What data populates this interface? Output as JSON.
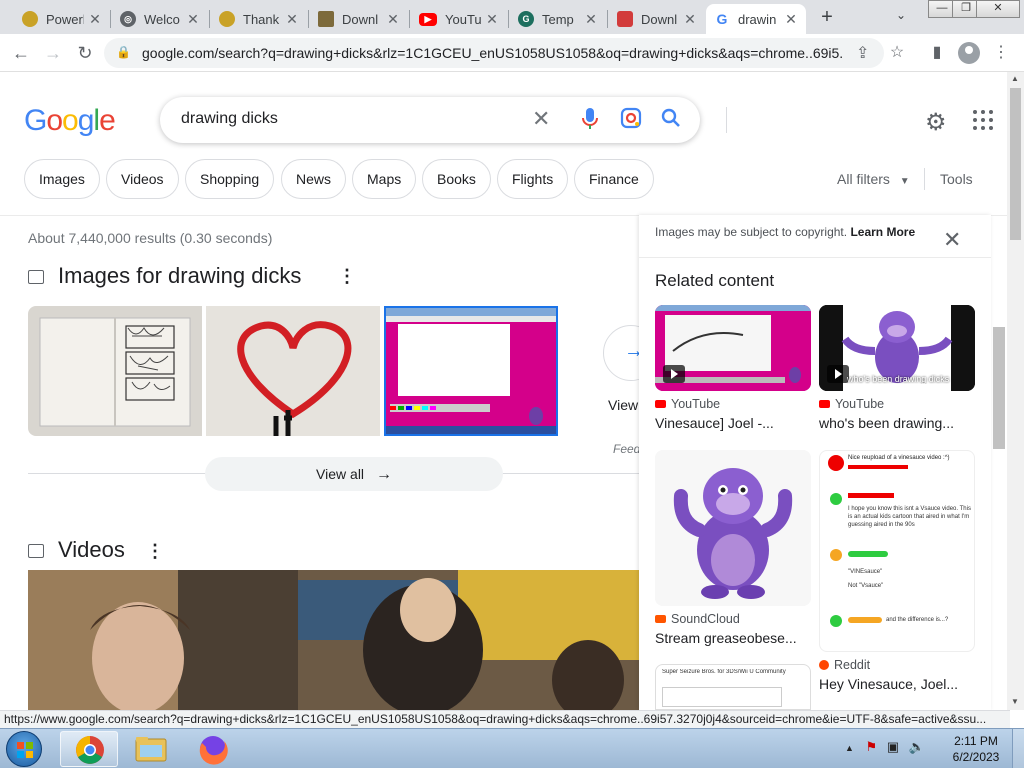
{
  "browser": {
    "tabs": [
      {
        "title": "Powerl",
        "icon": "coin-icon",
        "color": "#c9a227"
      },
      {
        "title": "Welco",
        "icon": "globe-icon",
        "color": "#5f6368"
      },
      {
        "title": "Thank",
        "icon": "coin-icon",
        "color": "#c9a227"
      },
      {
        "title": "Downl",
        "icon": "download-icon",
        "color": "#7d6a3b"
      },
      {
        "title": "YouTu",
        "icon": "youtube-icon",
        "color": "#ff0000"
      },
      {
        "title": "Temp",
        "icon": "temp-mail-icon",
        "color": "#1d6f5f"
      },
      {
        "title": "Downl",
        "icon": "download-page-icon",
        "color": "#d23b3b"
      },
      {
        "title": "drawin",
        "icon": "google-icon",
        "color": "#4285f4"
      }
    ],
    "url": "google.com/search?q=drawing+dicks&rlz=1C1GCEU_enUS1058US1058&oq=drawing+dicks&aqs=chrome..69i5...",
    "status_url": "https://www.google.com/search?q=drawing+dicks&rlz=1C1GCEU_enUS1058US1058&oq=drawing+dicks&aqs=chrome..69i57.3270j0j4&sourceid=chrome&ie=UTF-8&safe=active&ssu..."
  },
  "google": {
    "logo": "Google",
    "query": "drawing dicks",
    "filters": [
      "Images",
      "Videos",
      "Shopping",
      "News",
      "Maps",
      "Books",
      "Flights",
      "Finance"
    ],
    "all_filters": "All filters",
    "tools": "Tools",
    "stats": "About 7,440,000 results (0.30 seconds)",
    "images_heading": "Images for drawing dicks",
    "view_label": "View",
    "feedback_label": "Feed",
    "view_all": "View all",
    "videos_heading": "Videos"
  },
  "panel": {
    "copyright_text": "Images may be subject to copyright.",
    "learn_more": "Learn More",
    "related_heading": "Related content",
    "items": [
      {
        "source": "YouTube",
        "title": "Vinesauce] Joel -...",
        "source_color": "#ff0000"
      },
      {
        "source": "YouTube",
        "title": "who's been drawing...",
        "source_color": "#ff0000",
        "caption": "who's been drawing dicks"
      },
      {
        "source": "SoundCloud",
        "title": "Stream greaseobese...",
        "source_color": "#ff5500"
      },
      {
        "source": "Reddit",
        "title": "Hey Vinesauce, Joel...",
        "source_color": "#ff4500",
        "lines": [
          "Nice reupload of a vinesauce video :^)",
          "I hope you know this isnt a Vsauce video. This is an actual kids cartoon that aired in what I'm guessing aired in the 90s",
          "\"VINEsauce\"",
          "Not \"Vsauce\"",
          "and the difference is...?"
        ]
      }
    ],
    "partial_item_text": "Super Seizure Bros. for 3DS/Wii U Community"
  },
  "taskbar": {
    "time": "2:11 PM",
    "date": "6/2/2023"
  }
}
